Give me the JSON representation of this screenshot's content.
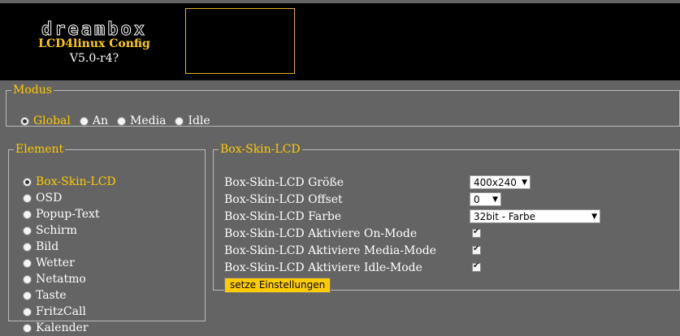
{
  "header": {
    "logo_word": "dreambox",
    "title": "LCD4linux Config",
    "version": "V5.0-r4?"
  },
  "modus": {
    "legend": "Modus",
    "options": [
      {
        "label": "Global",
        "checked": true
      },
      {
        "label": "An",
        "checked": false
      },
      {
        "label": "Media",
        "checked": false
      },
      {
        "label": "Idle",
        "checked": false
      }
    ]
  },
  "element": {
    "legend": "Element",
    "items": [
      {
        "label": "Box-Skin-LCD",
        "checked": true
      },
      {
        "label": "OSD",
        "checked": false
      },
      {
        "label": "Popup-Text",
        "checked": false
      },
      {
        "label": "Schirm",
        "checked": false
      },
      {
        "label": "Bild",
        "checked": false
      },
      {
        "label": "Wetter",
        "checked": false
      },
      {
        "label": "Netatmo",
        "checked": false
      },
      {
        "label": "Taste",
        "checked": false
      },
      {
        "label": "FritzCall",
        "checked": false
      },
      {
        "label": "Kalender",
        "checked": false
      }
    ]
  },
  "skin": {
    "legend": "Box-Skin-LCD",
    "rows": [
      {
        "label": "Box-Skin-LCD Größe",
        "type": "select",
        "value": "400x240"
      },
      {
        "label": "Box-Skin-LCD Offset",
        "type": "select",
        "value": "0"
      },
      {
        "label": "Box-Skin-LCD Farbe",
        "type": "select",
        "value": "32bit - Farbe"
      },
      {
        "label": "Box-Skin-LCD Aktiviere On-Mode",
        "type": "checkbox",
        "checked": true
      },
      {
        "label": "Box-Skin-LCD Aktiviere Media-Mode",
        "type": "checkbox",
        "checked": true
      },
      {
        "label": "Box-Skin-LCD Aktiviere Idle-Mode",
        "type": "checkbox",
        "checked": true
      }
    ],
    "submit_label": "setze Einstellungen"
  },
  "colors": {
    "accent": "#ffcc00",
    "background": "#646464",
    "header_bg": "#000000"
  }
}
